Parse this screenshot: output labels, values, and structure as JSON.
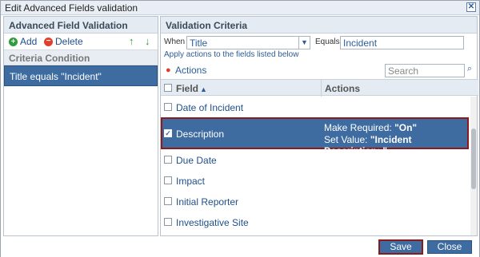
{
  "dialog": {
    "title": "Edit Advanced Fields validation",
    "close_icon": "close-icon"
  },
  "left_panel": {
    "header": "Advanced Field Validation",
    "add_label": "Add",
    "delete_label": "Delete",
    "criteria_header": "Criteria Condition",
    "criteria_items": [
      {
        "label": "Title equals \"Incident\""
      }
    ]
  },
  "right_panel": {
    "header": "Validation Criteria",
    "when_label": "When",
    "when_value": "Title",
    "equals_label": "Equals",
    "equals_value": "Incident",
    "apply_text": "Apply actions to the fields listed below",
    "actions_label": "Actions",
    "search_placeholder": "Search",
    "columns": {
      "field": "Field",
      "actions": "Actions"
    },
    "rows": [
      {
        "field": "Date of Incident",
        "checked": false
      },
      {
        "field": "Description",
        "checked": true,
        "actions": [
          {
            "label": "Make Required:",
            "value": "\"On\""
          },
          {
            "label": "Set Value:",
            "value": "\"Incident Description: \""
          }
        ]
      },
      {
        "field": "Due Date",
        "checked": false
      },
      {
        "field": "Impact",
        "checked": false
      },
      {
        "field": "Initial Reporter",
        "checked": false
      },
      {
        "field": "Investigative Site",
        "checked": false
      }
    ]
  },
  "footer": {
    "save_label": "Save",
    "close_label": "Close"
  },
  "colors": {
    "accent": "#3e6ca1",
    "highlight_border": "#8b1a1a",
    "header_bg": "#e4ebf2"
  }
}
